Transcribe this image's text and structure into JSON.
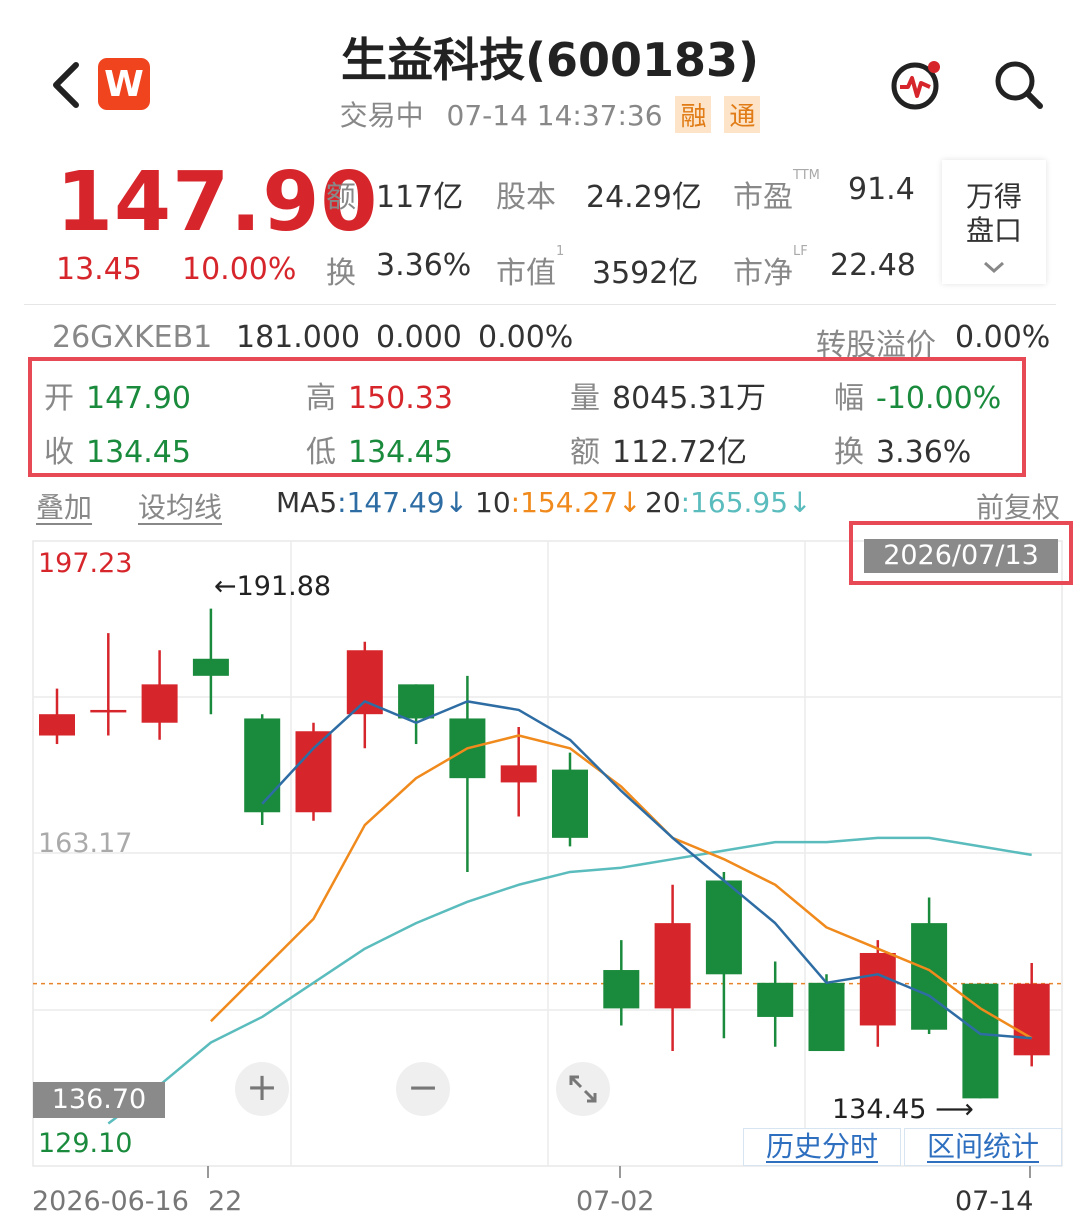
{
  "header": {
    "title": "生益科技(600183)",
    "status": "交易中",
    "datetime": "07-14 14:37:36",
    "tags": [
      "融",
      "通"
    ],
    "logo_letter": "W",
    "icons": [
      "back-arrow-icon",
      "w-logo-icon",
      "pulse-icon",
      "search-icon"
    ]
  },
  "quote": {
    "price": "147.90",
    "change": "13.45",
    "change_pct": "10.00%",
    "stats": [
      {
        "label": "额",
        "sup": "",
        "value": "117亿"
      },
      {
        "label": "股本",
        "sup": "",
        "value": "24.29亿"
      },
      {
        "label": "市盈",
        "sup": "TTM",
        "value": "91.4"
      },
      {
        "label": "换",
        "sup": "",
        "value": "3.36%"
      },
      {
        "label": "市值",
        "sup": "1",
        "value": "3592亿"
      },
      {
        "label": "市净",
        "sup": "LF",
        "value": "22.48"
      }
    ],
    "wind_panel_line1": "万得",
    "wind_panel_line2": "盘口",
    "colors": {
      "up": "#d6262c",
      "down": "#1a8a3c"
    }
  },
  "bond": {
    "code": "26GXKEB1",
    "price": "181.000",
    "change": "0.000",
    "pct": "0.00%",
    "premium_label": "转股溢价",
    "premium_value": "0.00%"
  },
  "ohlc": {
    "open_label": "开",
    "open": "147.90",
    "high_label": "高",
    "high": "150.33",
    "volume_label": "量",
    "volume": "8045.31万",
    "amplitude_label": "幅",
    "amplitude": "-10.00%",
    "close_label": "收",
    "close": "134.45",
    "low_label": "低",
    "low": "134.45",
    "amount_label": "额",
    "amount": "112.72亿",
    "turnover_label": "换",
    "turnover": "3.36%"
  },
  "ma_bar": {
    "overlay": "叠加",
    "set_ma": "设均线",
    "ma5_label": "MA5",
    "ma5_value": "147.49",
    "ma10_label": "10",
    "ma10_value": "154.27",
    "ma20_label": "20",
    "ma20_value": "165.95",
    "adjust": "前复权",
    "colors": {
      "ma5": "#2e6da4",
      "ma10": "#f08a1c",
      "ma20": "#5bbcbd"
    }
  },
  "chart_data": {
    "type": "candlestick",
    "selected_date": "2026/07/13",
    "y_max_label": "197.23",
    "y_mid_label": "163.17",
    "y_min_label": "129.10",
    "crosshair_value": "136.70",
    "max_annotation": "191.88",
    "min_annotation": "134.45",
    "x_labels": [
      "2026-06-16",
      "22",
      "07-02",
      "07-14"
    ],
    "ylim": [
      129.1,
      197.23
    ],
    "candles": [
      {
        "o": 177.0,
        "c": 179.5,
        "h": 182.5,
        "l": 176.0
      },
      {
        "o": 180.0,
        "c": 180.0,
        "h": 189.0,
        "l": 177.0
      },
      {
        "o": 178.5,
        "c": 183.0,
        "h": 187.0,
        "l": 176.5
      },
      {
        "o": 186.0,
        "c": 184.0,
        "h": 191.88,
        "l": 179.5
      },
      {
        "o": 179.0,
        "c": 168.0,
        "h": 179.5,
        "l": 166.5
      },
      {
        "o": 168.0,
        "c": 177.5,
        "h": 178.5,
        "l": 167.0
      },
      {
        "o": 179.5,
        "c": 187.0,
        "h": 188.0,
        "l": 175.5
      },
      {
        "o": 183.0,
        "c": 179.0,
        "h": 183.0,
        "l": 176.0
      },
      {
        "o": 179.0,
        "c": 172.0,
        "h": 184.0,
        "l": 161.0
      },
      {
        "o": 171.5,
        "c": 173.5,
        "h": 178.0,
        "l": 167.5
      },
      {
        "o": 173.0,
        "c": 165.0,
        "h": 175.0,
        "l": 164.0
      },
      {
        "o": 149.5,
        "c": 145.0,
        "h": 153.0,
        "l": 143.0
      },
      {
        "o": 145.0,
        "c": 155.0,
        "h": 159.5,
        "l": 140.0
      },
      {
        "o": 160.0,
        "c": 149.0,
        "h": 161.0,
        "l": 141.5
      },
      {
        "o": 148.0,
        "c": 144.0,
        "h": 150.5,
        "l": 140.5
      },
      {
        "o": 148.0,
        "c": 140.0,
        "h": 149.0,
        "l": 140.0
      },
      {
        "o": 143.0,
        "c": 151.5,
        "h": 153.0,
        "l": 140.5
      },
      {
        "o": 155.0,
        "c": 142.5,
        "h": 158.0,
        "l": 142.0
      },
      {
        "o": 147.9,
        "c": 134.45,
        "h": 147.9,
        "l": 134.45
      },
      {
        "o": 139.5,
        "c": 147.9,
        "h": 150.33,
        "l": 138.2
      }
    ],
    "ma5": [
      null,
      null,
      null,
      null,
      169.0,
      175.5,
      181.0,
      178.5,
      181.0,
      180.0,
      176.5,
      170.5,
      165.0,
      160.0,
      155.0,
      148.0,
      149.0,
      146.5,
      142.0,
      141.5
    ],
    "ma10": [
      null,
      null,
      null,
      143.5,
      149.5,
      155.5,
      166.5,
      172.0,
      175.5,
      177.0,
      175.5,
      171.0,
      165.0,
      162.5,
      159.5,
      154.5,
      152.0,
      149.5,
      145.0,
      141.5
    ],
    "ma20": [
      null,
      131.5,
      136.0,
      141.0,
      144.0,
      148.0,
      152.0,
      155.0,
      157.5,
      159.5,
      161.0,
      161.5,
      162.5,
      163.5,
      164.5,
      164.5,
      165.0,
      165.0,
      164.0,
      163.0
    ],
    "last_close_line": 147.9
  },
  "chart_controls": {
    "zoom_in": "+",
    "zoom_out": "−",
    "expand_icon": "expand-icon",
    "history_link": "历史分时",
    "range_link": "区间统计"
  }
}
